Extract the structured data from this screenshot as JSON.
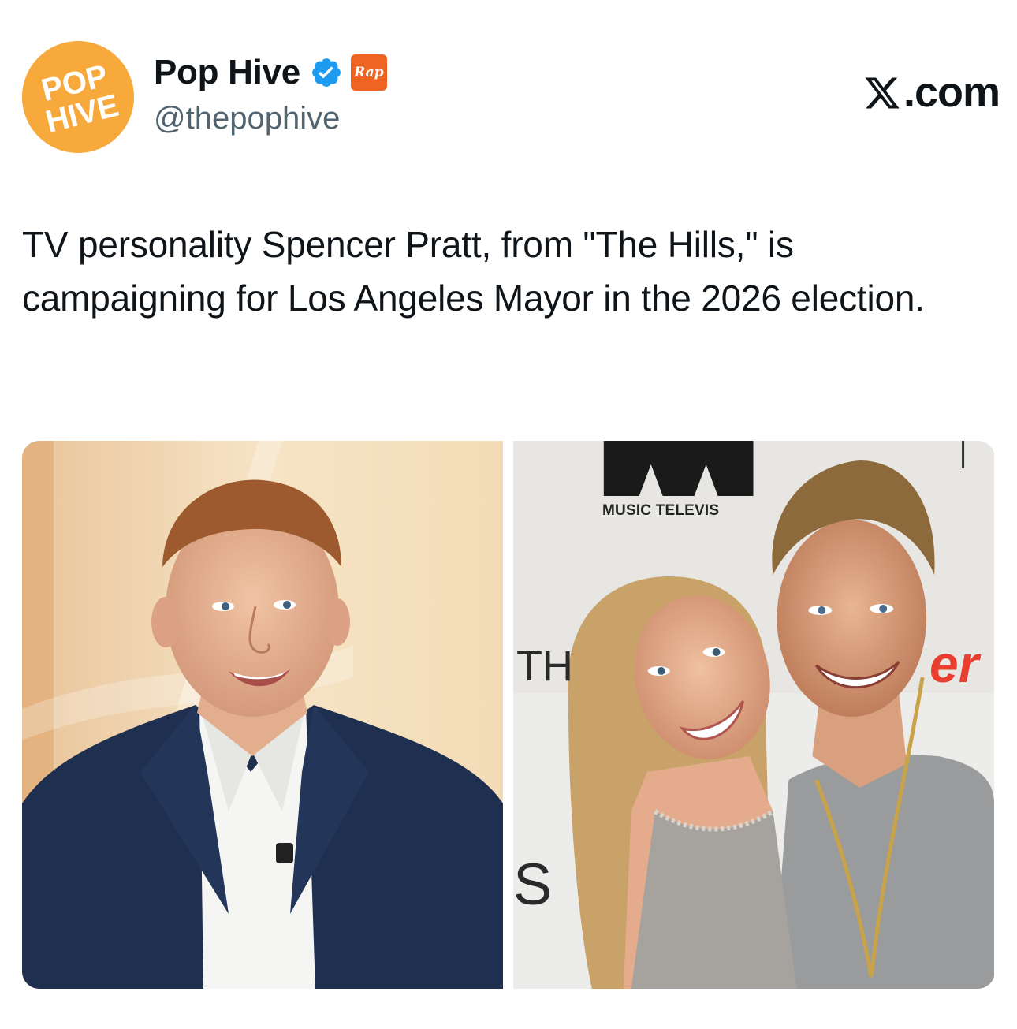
{
  "author": {
    "display_name": "Pop Hive",
    "handle": "@thepophive",
    "avatar_text_line1": "POP",
    "avatar_text_line2": "HIVE",
    "affiliate_badge_text": "Rap",
    "verified_icon": "verified-badge-icon"
  },
  "brand": {
    "label": ".com",
    "icon": "x-logo-icon"
  },
  "tweet": {
    "text": "TV personality Spencer Pratt, from \"The Hills,\" is campaigning for Los Angeles Mayor in the 2026 election."
  },
  "media": {
    "right_photo_caption": "MUSIC TELEVIS",
    "wall_text_th": "TH",
    "wall_text_s": "S",
    "wall_text_er": "er"
  },
  "colors": {
    "avatar_bg": "#f7a93c",
    "verified_blue": "#1d9bf0",
    "affiliate_orange": "#f06423",
    "handle_gray": "#536471",
    "text": "#0f1419"
  }
}
